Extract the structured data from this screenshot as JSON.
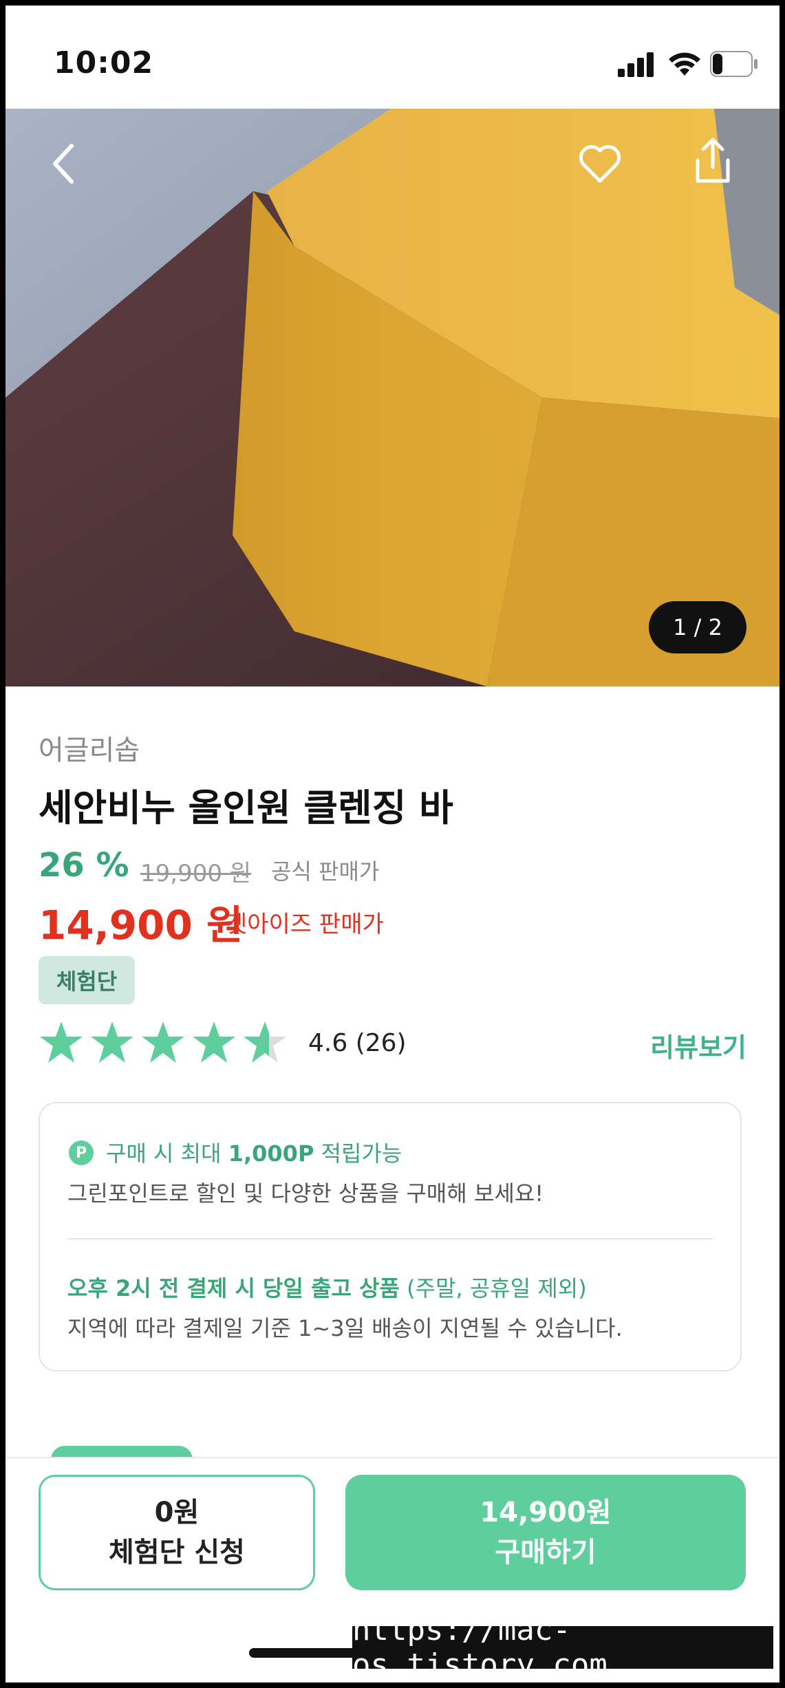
{
  "status_bar": {
    "time": "10:02",
    "battery": "22"
  },
  "hero": {
    "counter": "1 / 2"
  },
  "product": {
    "brand": "어글리솝",
    "title": "세안비누 올인원 클렌징 바",
    "discount": "26 %",
    "original_price": "19,900 원",
    "original_label": "공식 판매가",
    "price": "14,900 원",
    "price_label": "겟아이즈 판매가",
    "badge": "체험단",
    "rating_value": 4.6,
    "rating_text": "4.6 (26)",
    "review_link": "리뷰보기"
  },
  "info": {
    "point_icon": "P",
    "point_prefix": "구매 시 최대 ",
    "point_bold": "1,000P",
    "point_suffix": " 적립가능",
    "point_desc": "그린포인트로 할인 및 다양한 상품을 구매해 보세요!",
    "ship_bold": "오후 2시 전 결제 시 당일 출고 상품",
    "ship_suffix": " (주말, 공휴일 제외)",
    "ship_desc": "지역에 따라 결제일 기준 1~3일 배송이 지연될 수 있습니다."
  },
  "buttons": {
    "trial_price": "0원",
    "trial_label": "체험단 신청",
    "buy_price": "14,900원",
    "buy_label": "구매하기"
  },
  "watermark": "https://mac-os.tistory.com",
  "colors": {
    "accent": "#5fce9d",
    "green_text": "#3aa57a",
    "price_red": "#e0301e"
  }
}
